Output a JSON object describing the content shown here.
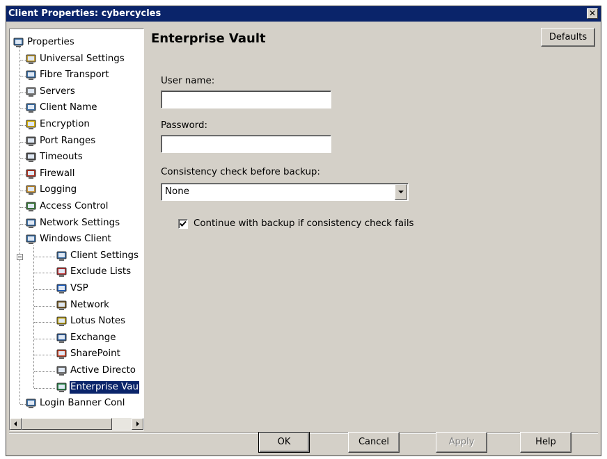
{
  "window": {
    "title": "Client Properties: cybercycles",
    "close_label": "✕"
  },
  "tree": {
    "items": [
      {
        "label": "Properties",
        "icon": "computer-icon"
      },
      {
        "label": "Universal Settings",
        "icon": "settings-icon"
      },
      {
        "label": "Fibre Transport",
        "icon": "fibre-transport-icon"
      },
      {
        "label": "Servers",
        "icon": "server-icon"
      },
      {
        "label": "Client Name",
        "icon": "computer-icon"
      },
      {
        "label": "Encryption",
        "icon": "lock-icon"
      },
      {
        "label": "Port Ranges",
        "icon": "port-icon"
      },
      {
        "label": "Timeouts",
        "icon": "clock-icon"
      },
      {
        "label": "Firewall",
        "icon": "firewall-icon"
      },
      {
        "label": "Logging",
        "icon": "log-icon"
      },
      {
        "label": "Access Control",
        "icon": "access-control-icon"
      },
      {
        "label": "Network Settings",
        "icon": "network-icon"
      },
      {
        "label": "Windows Client",
        "icon": "windows-client-icon"
      },
      {
        "label": "Client Settings",
        "icon": "computer-icon"
      },
      {
        "label": "Exclude Lists",
        "icon": "exclude-list-icon"
      },
      {
        "label": "VSP",
        "icon": "vsp-icon"
      },
      {
        "label": "Network",
        "icon": "network-plug-icon"
      },
      {
        "label": "Lotus Notes",
        "icon": "lotus-notes-icon"
      },
      {
        "label": "Exchange",
        "icon": "exchange-icon"
      },
      {
        "label": "SharePoint",
        "icon": "sharepoint-icon"
      },
      {
        "label": "Active Directo",
        "icon": "active-directory-icon"
      },
      {
        "label": "Enterprise Vau",
        "icon": "enterprise-vault-icon"
      },
      {
        "label": "Login Banner Conl",
        "icon": "login-banner-icon"
      }
    ],
    "selected_index": 21
  },
  "panel": {
    "heading": "Enterprise Vault",
    "defaults_label": "Defaults",
    "username_label": "User name:",
    "username_value": "",
    "password_label": "Password:",
    "password_value": "",
    "consistency_label": "Consistency check before backup:",
    "consistency_value": "None",
    "continue_label": "Continue with backup if consistency check fails",
    "continue_checked": true
  },
  "buttons": {
    "ok": "OK",
    "cancel": "Cancel",
    "apply": "Apply",
    "help": "Help"
  },
  "colors": {
    "title_bar": "#0a246a",
    "selection": "#0a246a",
    "face": "#d4d0c8"
  }
}
